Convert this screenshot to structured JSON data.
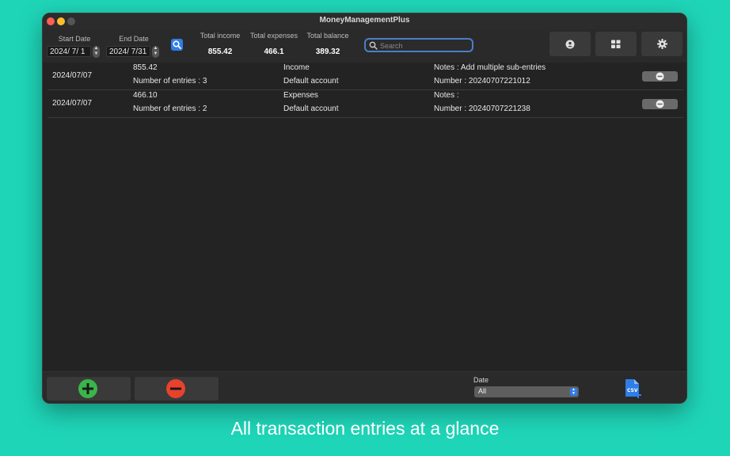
{
  "window": {
    "title": "MoneyManagementPlus"
  },
  "toolbar": {
    "start_date_label": "Start Date",
    "start_date_value": "2024/  7/  1",
    "end_date_label": "End Date",
    "end_date_value": "2024/  7/31",
    "total_income_label": "Total income",
    "total_income_value": "855.42",
    "total_expenses_label": "Total expenses",
    "total_expenses_value": "466.1",
    "total_balance_label": "Total balance",
    "total_balance_value": "389.32",
    "search_placeholder": "Search",
    "icons": [
      "magnifier-icon",
      "account-icon",
      "grid-icon",
      "gear-icon"
    ]
  },
  "entries": [
    {
      "date": "2024/07/07",
      "amount": "855.42",
      "count": "Number of entries : 3",
      "type": "Income",
      "account": "Default account",
      "notes": "Notes : Add multiple sub-entries",
      "number": "Number : 20240707221012"
    },
    {
      "date": "2024/07/07",
      "amount": "466.10",
      "count": "Number of entries : 2",
      "type": "Expenses",
      "account": "Default account",
      "notes": "Notes :",
      "number": "Number : 20240707221238"
    }
  ],
  "bottom": {
    "sort_label": "Date",
    "sort_value": "All"
  },
  "colors": {
    "background": "#1fd5b8",
    "window": "#232323",
    "accent": "#2f7ee8",
    "add": "#3ab54a",
    "remove": "#e8422d"
  },
  "caption": "All transaction entries at a glance"
}
